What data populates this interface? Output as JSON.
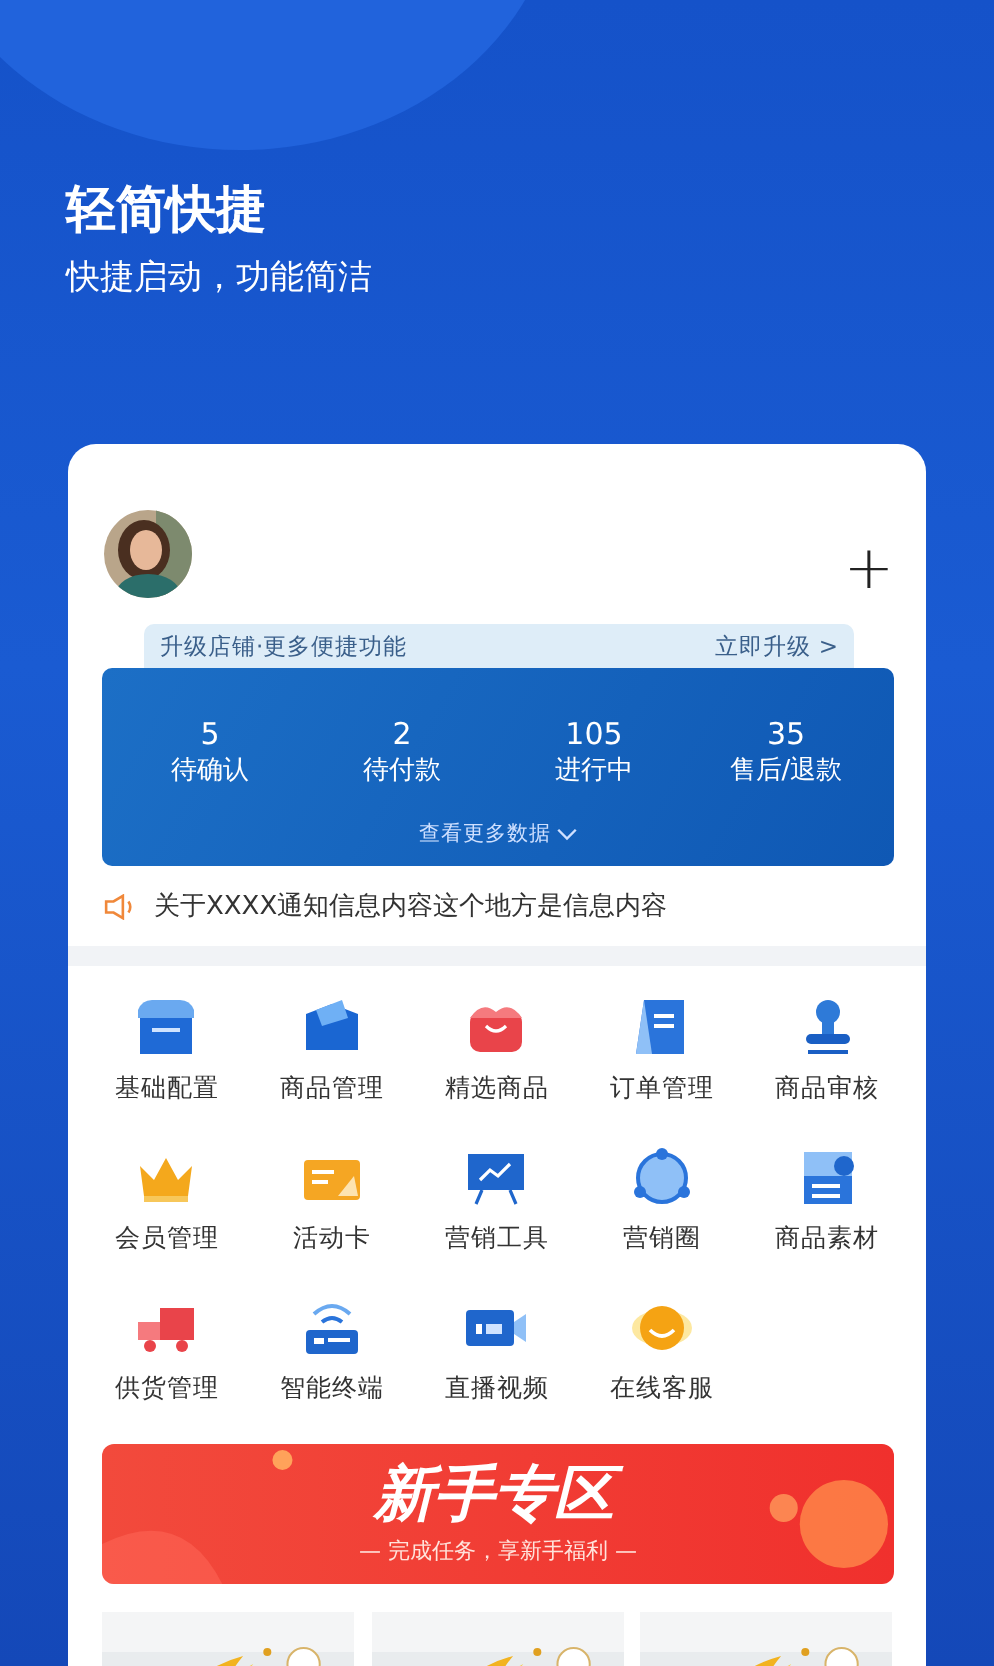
{
  "header": {
    "title": "轻简快捷",
    "subtitle": "快捷启动，功能简洁"
  },
  "store": {
    "add_button": "+"
  },
  "upgrade": {
    "text": "升级店铺·更多便捷功能",
    "link": "立即升级 >"
  },
  "stats": [
    {
      "value": "5",
      "label": "待确认"
    },
    {
      "value": "2",
      "label": "待付款"
    },
    {
      "value": "105",
      "label": "进行中"
    },
    {
      "value": "35",
      "label": "售后/退款"
    }
  ],
  "more_data": "查看更多数据",
  "notice": "关于XXXX通知信息内容这个地方是信息内容",
  "functions": [
    {
      "label": "基础配置"
    },
    {
      "label": "商品管理"
    },
    {
      "label": "精选商品"
    },
    {
      "label": "订单管理"
    },
    {
      "label": "商品审核"
    },
    {
      "label": "会员管理"
    },
    {
      "label": "活动卡"
    },
    {
      "label": "营销工具"
    },
    {
      "label": "营销圈"
    },
    {
      "label": "商品素材"
    },
    {
      "label": "供货管理"
    },
    {
      "label": "智能终端"
    },
    {
      "label": "直播视频"
    },
    {
      "label": "在线客服"
    }
  ],
  "banner": {
    "title": "新手专区",
    "subtitle": "— 完成任务，享新手福利 —"
  }
}
